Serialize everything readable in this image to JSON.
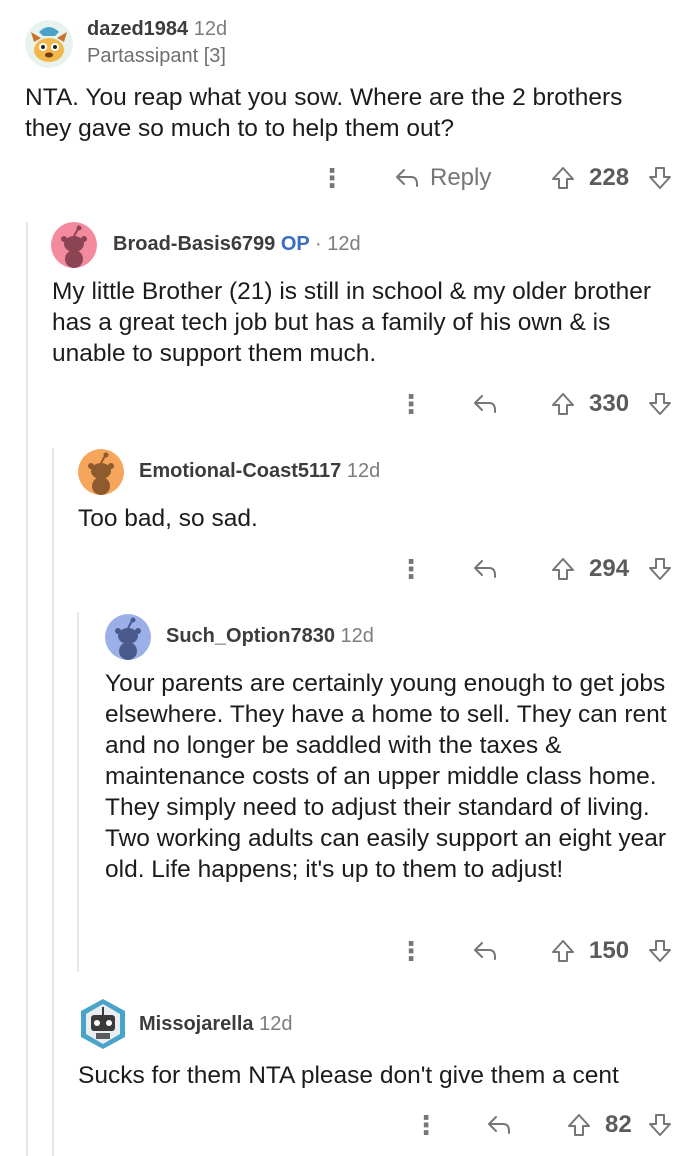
{
  "comments": [
    {
      "username": "dazed1984",
      "time": "12d",
      "flair": "Partassipant [3]",
      "op_badge": "",
      "body": "NTA. You reap what you sow. Where are the 2 brothers they gave so much to to help them out?",
      "reply_label": "Reply",
      "score": "228",
      "avatar_color": "#f2b84b"
    },
    {
      "username": "Broad-Basis6799",
      "time": "12d",
      "op_badge": "OP",
      "separator": "·",
      "body": "My little Brother (21)  is still in school & my older brother has a great tech job but has a family of his own & is unable to support them much.",
      "score": "330",
      "avatar_color": "#f48a9e"
    },
    {
      "username": "Emotional-Coast5117",
      "time": "12d",
      "body": "Too bad, so sad.",
      "score": "294",
      "avatar_color": "#f5a55c"
    },
    {
      "username": "Such_Option7830",
      "time": "12d",
      "body": "Your parents are certainly young enough to get jobs elsewhere. They have a home to sell. They can rent and no longer be saddled with the taxes & maintenance costs of an upper middle class home. They simply need to adjust their standard of living. Two working adults can easily support an eight year old. Life happens; it's up to them to adjust!",
      "score": "150",
      "avatar_color": "#9bb0e8"
    },
    {
      "username": "Missojarella",
      "time": "12d",
      "body": "Sucks for them NTA please don't give them a cent",
      "score": "82",
      "avatar_color": "#5fb3d6"
    }
  ],
  "icons": {
    "more": "more-options-icon",
    "reply": "reply-arrow-icon",
    "upvote": "upvote-arrow-icon",
    "downvote": "downvote-arrow-icon"
  }
}
